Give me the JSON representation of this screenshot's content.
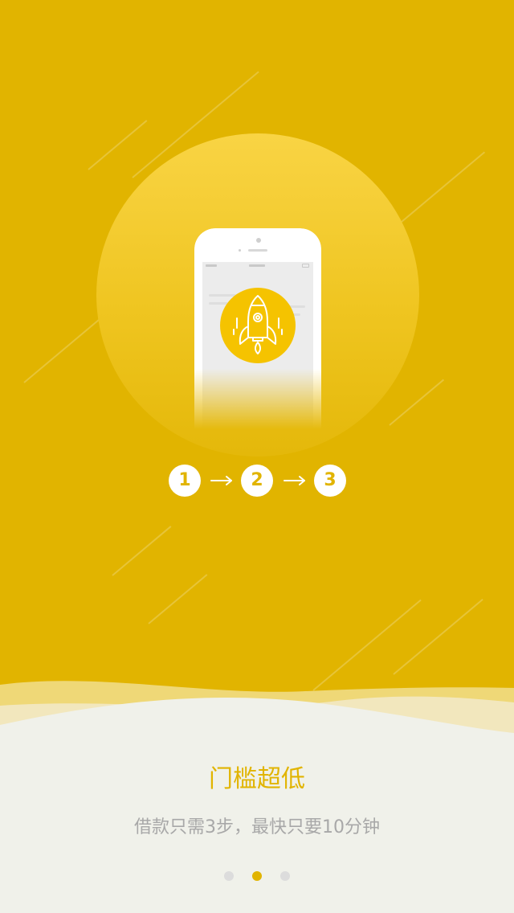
{
  "onboarding": {
    "title": "门槛超低",
    "subtitle": "借款只需3步，最快只要10分钟",
    "steps": [
      "1",
      "2",
      "3"
    ],
    "page_indicator": {
      "current": 2,
      "total": 3
    },
    "illustration": {
      "icon": "rocket-icon",
      "device": "phone"
    }
  },
  "colors": {
    "background": "#e1b400",
    "accent": "#e1b400",
    "badge": "#f5c300",
    "text_secondary": "#a8a8a8",
    "dot_active": "#e1b400",
    "dot_inactive": "#dcdcdc",
    "wave_base": "#f0f1ea"
  }
}
